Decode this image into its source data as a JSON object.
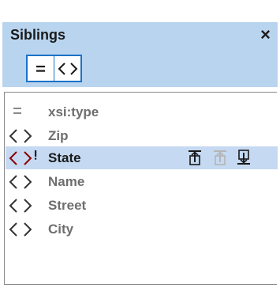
{
  "window": {
    "title": "Siblings",
    "close_symbol": "×"
  },
  "toolbar": {
    "buttons": [
      {
        "name": "show-attributes",
        "icon": "equals-icon",
        "state": "active"
      },
      {
        "name": "show-elements",
        "icon": "element-brackets-icon",
        "state": "active"
      }
    ]
  },
  "list": {
    "items": [
      {
        "label": "xsi:type",
        "kind": "attribute",
        "icon": "equals-icon"
      },
      {
        "label": "Zip",
        "kind": "element",
        "icon": "element-brackets-icon"
      },
      {
        "label": "State",
        "kind": "element",
        "icon": "required-element-icon",
        "selected": true
      },
      {
        "label": "Name",
        "kind": "element",
        "icon": "element-brackets-icon"
      },
      {
        "label": "Street",
        "kind": "element",
        "icon": "element-brackets-icon"
      },
      {
        "label": "City",
        "kind": "element",
        "icon": "element-brackets-icon"
      }
    ],
    "selected_row_actions": [
      {
        "name": "move-to-top",
        "icon": "move-top-icon",
        "enabled": true
      },
      {
        "name": "move-up",
        "icon": "move-up-icon",
        "enabled": false
      },
      {
        "name": "move-to-bottom",
        "icon": "move-bottom-icon",
        "enabled": true
      }
    ]
  },
  "colors": {
    "header_bg": "#b9d4ef",
    "selection_bg": "#c5daf2",
    "accent": "#1a72c8",
    "muted_text": "#6e6e6e",
    "disabled_icon": "#b5b5b5"
  }
}
